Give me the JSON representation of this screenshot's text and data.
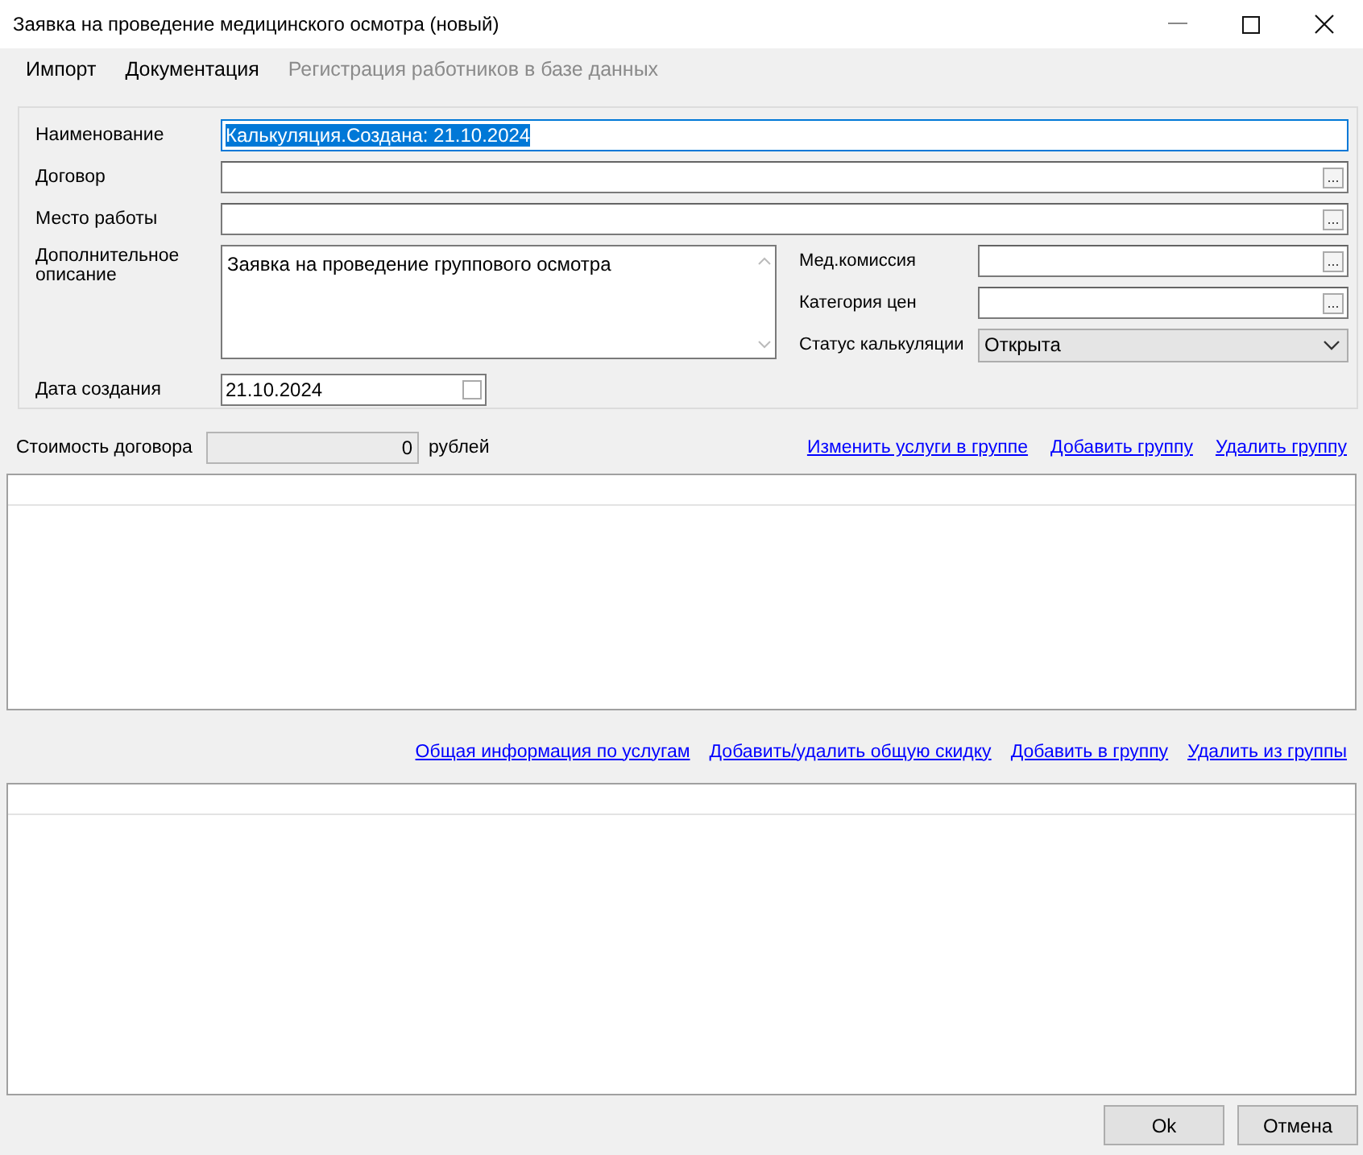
{
  "window": {
    "title": "Заявка на проведение медицинского осмотра (новый)"
  },
  "menu": [
    {
      "label": "Импорт",
      "disabled": false
    },
    {
      "label": "Документация",
      "disabled": false
    },
    {
      "label": "Регистрация работников в базе данных",
      "disabled": true
    }
  ],
  "top_fields": [
    {
      "kind": "text",
      "label": "Наименование",
      "value": "Калькуляция.Создана: 21.10.2024",
      "focused": true,
      "selected": true
    },
    {
      "kind": "lookup",
      "label": "Договор",
      "button": "..."
    },
    {
      "kind": "lookup",
      "label": "Место работы",
      "button": "..."
    }
  ],
  "description": {
    "label": "Дополнительное описание",
    "value": "Заявка на проведение группового осмотра"
  },
  "right_fields": [
    {
      "kind": "lookup",
      "label": "Мед.комиссия",
      "button": "..."
    },
    {
      "kind": "lookup",
      "label": "Категория цен",
      "button": "..."
    },
    {
      "kind": "select",
      "label": "Статус калькуляции",
      "value": "Открыта"
    }
  ],
  "date": {
    "label": "Дата создания",
    "value": "21.10.2024",
    "checked": false
  },
  "cost": {
    "label": "Стоимость договора",
    "value": "0",
    "unit": "рублей"
  },
  "group_links": [
    "Изменить услуги в группе",
    "Добавить группу",
    "Удалить группу"
  ],
  "service_links": [
    "Общая информация по услугам",
    "Добавить/удалить общую скидку",
    "Добавить в группу",
    "Удалить из группы"
  ],
  "buttons": [
    "Ok",
    "Отмена"
  ]
}
